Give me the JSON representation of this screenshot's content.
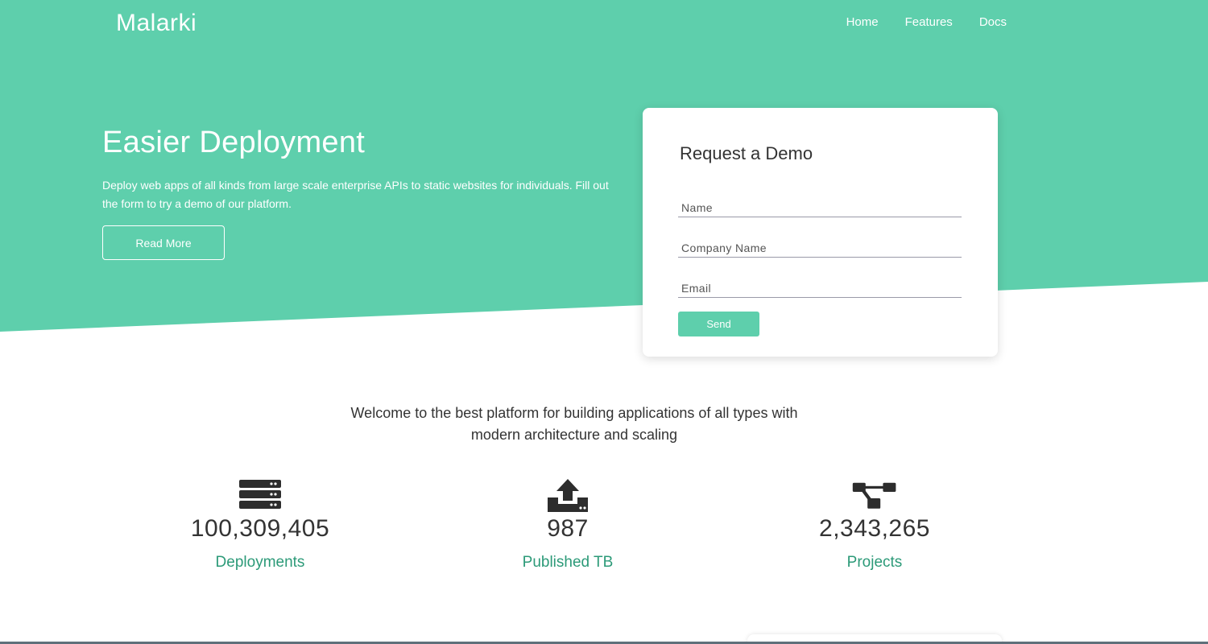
{
  "brand": "Malarki",
  "nav": {
    "items": [
      "Home",
      "Features",
      "Docs"
    ]
  },
  "hero": {
    "title": "Easier Deployment",
    "description": "Deploy web apps of all kinds from large scale enterprise APIs to static websites for individuals. Fill out the form to try a demo of our platform.",
    "read_more_label": "Read More"
  },
  "demo_form": {
    "title": "Request a Demo",
    "name_placeholder": "Name",
    "company_placeholder": "Company Name",
    "email_placeholder": "Email",
    "send_label": "Send"
  },
  "welcome": "Welcome to the best platform for building applications of all types with modern architecture and scaling",
  "stats": [
    {
      "icon": "server-icon",
      "value": "100,309,405",
      "label": "Deployments"
    },
    {
      "icon": "upload-icon",
      "value": "987",
      "label": "Published TB"
    },
    {
      "icon": "sitemap-icon",
      "value": "2,343,265",
      "label": "Projects"
    }
  ],
  "colors": {
    "accent": "#5ecfac",
    "label": "#2c9a78",
    "text": "#333333",
    "icon": "#2d2d2d"
  }
}
